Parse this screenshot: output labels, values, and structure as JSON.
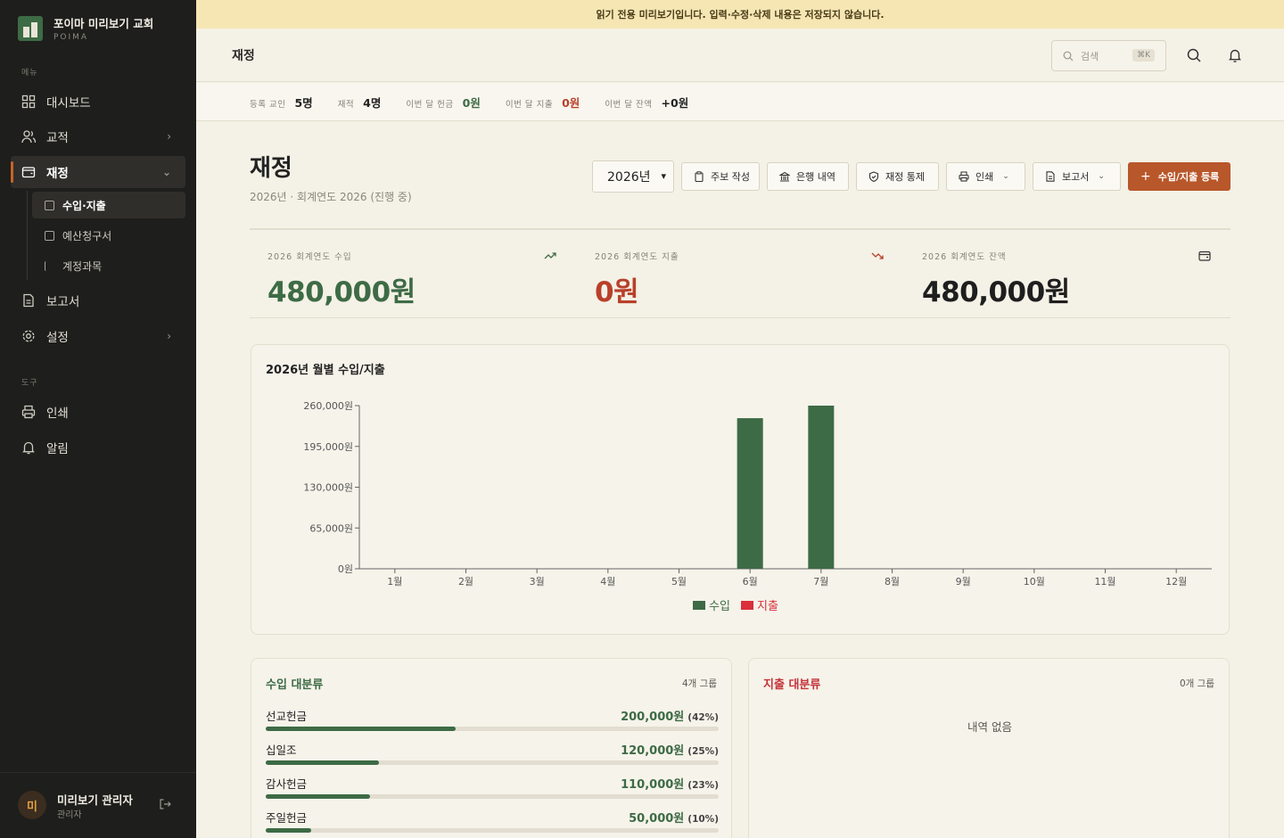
{
  "brand": {
    "name": "포이마 미리보기 교회",
    "sub": "POIMA"
  },
  "sidebar": {
    "menu_label": "메뉴",
    "tools_label": "도구",
    "items": [
      {
        "label": "대시보드"
      },
      {
        "label": "교적"
      },
      {
        "label": "재정"
      },
      {
        "label": "보고서"
      },
      {
        "label": "설정"
      }
    ],
    "sub_items": [
      {
        "label": "수입·지출"
      },
      {
        "label": "예산청구서"
      },
      {
        "label": "계정과목"
      }
    ],
    "tools": [
      {
        "label": "인쇄"
      },
      {
        "label": "알림"
      }
    ]
  },
  "user": {
    "initial": "미",
    "name": "미리보기 관리자",
    "role": "관리자"
  },
  "banner": {
    "text": "읽기 전용 미리보기입니다. 입력·수정·삭제 내용은 저장되지 않습니다."
  },
  "header": {
    "title": "재정",
    "search_placeholder": "검색",
    "shortcut": "⌘K"
  },
  "stats": [
    {
      "label": "등록 교인",
      "value": "5명",
      "color": "#222222"
    },
    {
      "label": "재적",
      "value": "4명",
      "color": "#222222"
    },
    {
      "label": "이번 달 헌금",
      "value": "0원",
      "color": "#3d6b45"
    },
    {
      "label": "이번 달 지출",
      "value": "0원",
      "color": "#b8402a"
    },
    {
      "label": "이번 달 잔액",
      "value": "+0원",
      "color": "#222222"
    }
  ],
  "page": {
    "title": "재정",
    "subtitle": "2026년 · 회계연도 2026 (진행 중)",
    "year_select": "2026년",
    "buttons": {
      "weekly": "주보 작성",
      "bank": "은행 내역",
      "control": "재정 통제",
      "print": "인쇄",
      "report": "보고서",
      "register": "수입/지출 등록"
    }
  },
  "kpis": [
    {
      "label": "2026 회계연도 수입",
      "value": "480,000원",
      "color": "#3d6b45",
      "icon": "trend-up-icon"
    },
    {
      "label": "2026 회계연도 지출",
      "value": "0원",
      "color": "#b8402a",
      "icon": "trend-down-icon"
    },
    {
      "label": "2026 회계연도 잔액",
      "value": "480,000원",
      "color": "#1e1e1e",
      "icon": "wallet-icon"
    }
  ],
  "chart_title": "2026년 월별 수입/지출",
  "chart_data": {
    "type": "bar",
    "title": "2026년 월별 수입/지출",
    "categories": [
      "1월",
      "2월",
      "3월",
      "4월",
      "5월",
      "6월",
      "7월",
      "8월",
      "9월",
      "10월",
      "11월",
      "12월"
    ],
    "series": [
      {
        "name": "수입",
        "color": "#3d6b45",
        "values": [
          0,
          0,
          0,
          0,
          0,
          240000,
          260000,
          0,
          0,
          0,
          0,
          0
        ]
      },
      {
        "name": "지출",
        "color": "#d9303c",
        "values": [
          0,
          0,
          0,
          0,
          0,
          0,
          0,
          0,
          0,
          0,
          0,
          0
        ]
      }
    ],
    "yticks": [
      0,
      65000,
      130000,
      195000,
      260000
    ],
    "ytick_labels": [
      "0원",
      "65,000원",
      "130,000원",
      "195,000원",
      "260,000원"
    ],
    "ylim": [
      0,
      260000
    ],
    "legend": "bottom-center",
    "grid": false
  },
  "income_categories": {
    "title": "수입 대분류",
    "count": "4개 그룹",
    "items": [
      {
        "name": "선교헌금",
        "amount": "200,000원",
        "pct": "(42%)",
        "ratio": 0.42
      },
      {
        "name": "십일조",
        "amount": "120,000원",
        "pct": "(25%)",
        "ratio": 0.25
      },
      {
        "name": "감사헌금",
        "amount": "110,000원",
        "pct": "(23%)",
        "ratio": 0.23
      },
      {
        "name": "주일헌금",
        "amount": "50,000원",
        "pct": "(10%)",
        "ratio": 0.1
      }
    ]
  },
  "expense_categories": {
    "title": "지출 대분류",
    "count": "0개 그룹",
    "empty": "내역 없음"
  }
}
